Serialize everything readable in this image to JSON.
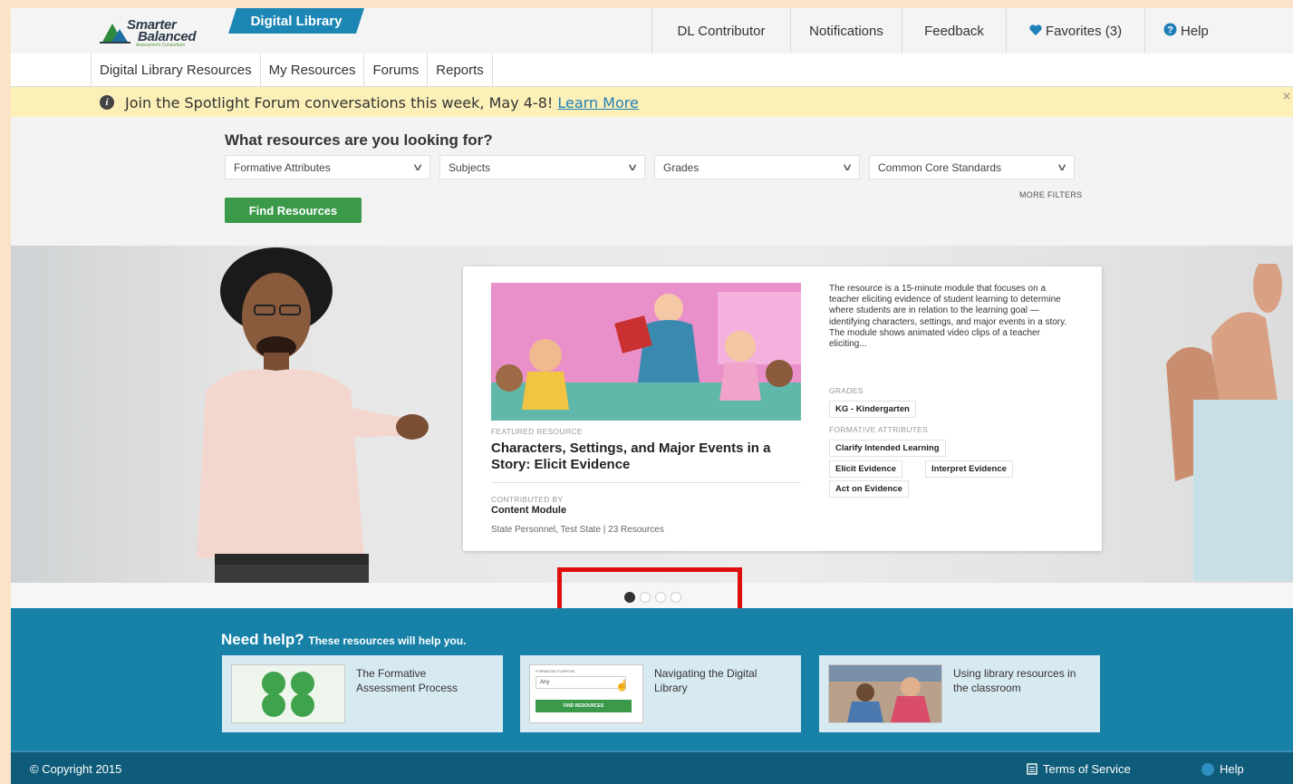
{
  "header": {
    "logo_line1": "Smarter",
    "logo_line2": "Balanced",
    "logo_line3": "Assessment Consortium",
    "app_tab": "Digital Library",
    "nav": [
      {
        "label": "DL Contributor"
      },
      {
        "label": "Notifications"
      },
      {
        "label": "Feedback"
      },
      {
        "label": "Favorites (3)"
      },
      {
        "label": "Help"
      }
    ]
  },
  "subnav": {
    "tabs": [
      {
        "label": "Digital Library Resources"
      },
      {
        "label": "My Resources"
      },
      {
        "label": "Forums"
      },
      {
        "label": "Reports"
      }
    ]
  },
  "banner": {
    "message": "Join the Spotlight Forum conversations this week, May 4-8! ",
    "link": "Learn More",
    "close": "×"
  },
  "search": {
    "title": "What resources are you looking for?",
    "filters": [
      {
        "label": "Formative Attributes"
      },
      {
        "label": "Subjects"
      },
      {
        "label": "Grades"
      },
      {
        "label": "Common Core Standards"
      }
    ],
    "more_filters": "MORE FILTERS",
    "button": "Find Resources"
  },
  "featured": {
    "label": "FEATURED RESOURCE",
    "title": "Characters, Settings, and Major Events in a Story: Elicit Evidence",
    "contributed_label": "CONTRIBUTED BY",
    "contributor": "Content Module",
    "meta": "State Personnel, Test State  |  23 Resources",
    "description": "The resource is a 15-minute module that focuses on a teacher eliciting evidence of student learning to determine where students are in relation to the learning goal — identifying characters, settings, and major events in a story. The module shows animated video clips of a teacher eliciting...",
    "grades_label": "GRADES",
    "grade": "KG - Kindergarten",
    "attributes_label": "FORMATIVE ATTRIBUTES",
    "attributes": [
      "Clarify Intended Learning",
      "Elicit Evidence",
      "Interpret Evidence",
      "Act on Evidence"
    ]
  },
  "carousel": {
    "slide_count": 4,
    "active_index": 0
  },
  "help": {
    "title": "Need help?",
    "subtitle": "These resources will help you.",
    "cards": [
      {
        "label": "The Formative Assessment Process"
      },
      {
        "label": "Navigating the Digital Library"
      },
      {
        "label": "Using library resources in the classroom"
      }
    ],
    "thumb2_field_label": "FORMATIVE PURPOSE",
    "thumb2_field_value": "Any",
    "thumb2_button": "FIND RESOURCES"
  },
  "footer": {
    "copyright": "© Copyright 2015",
    "terms": "Terms of Service",
    "help": "Help"
  },
  "colors": {
    "brand_blue": "#1c86b5",
    "green_button": "#3a9a49",
    "banner_yellow": "#fbf0b7",
    "highlight_red": "#e00d0d",
    "help_bg": "#1781a8",
    "footer_bg": "#0f5c7a"
  }
}
